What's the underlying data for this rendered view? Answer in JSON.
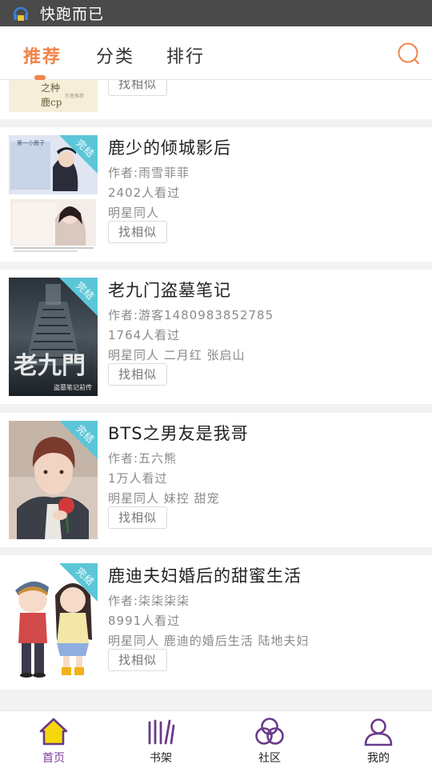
{
  "status_bar": {
    "app_name": "快跑而已"
  },
  "top_nav": {
    "tabs": [
      {
        "label": "推荐",
        "active": true
      },
      {
        "label": "分类",
        "active": false
      },
      {
        "label": "排行",
        "active": false
      }
    ],
    "accent_color": "#f0844a"
  },
  "partial_card": {
    "cover_text": "之种\n鹿cp",
    "similar_label": "找相似"
  },
  "books": [
    {
      "title": "鹿少的倾城影后",
      "author": "作者:雨雪菲菲",
      "views": "2402人看过",
      "tags": "明星同人",
      "similar_label": "找相似",
      "badge": "完结",
      "cover_icon": "cover-collage-portraits"
    },
    {
      "title": "老九门盗墓笔记",
      "author": "作者:游客1480983852785",
      "views": "1764人看过",
      "tags": "明星同人 二月红 张启山",
      "similar_label": "找相似",
      "badge": "完结",
      "cover_icon": "cover-dark-stairway",
      "cover_text": "老九門",
      "cover_subtext": "盗墓笔记前传"
    },
    {
      "title": "BTS之男友是我哥",
      "author": "作者:五六熊",
      "views": "1万人看过",
      "tags": "明星同人 妹控 甜宠",
      "similar_label": "找相似",
      "badge": "完结",
      "cover_icon": "cover-boy-with-rose"
    },
    {
      "title": "鹿迪夫妇婚后的甜蜜生活",
      "author": "作者:柒柒柒柒",
      "views": "8991人看过",
      "tags": "明星同人 鹿迪的婚后生活 陆地夫妇",
      "similar_label": "找相似",
      "badge": "完结",
      "cover_icon": "cover-cartoon-couple"
    }
  ],
  "bottom_nav": {
    "items": [
      {
        "label": "首页",
        "icon": "home-icon",
        "active": true
      },
      {
        "label": "书架",
        "icon": "bookshelf-icon",
        "active": false
      },
      {
        "label": "社区",
        "icon": "community-icon",
        "active": false
      },
      {
        "label": "我的",
        "icon": "profile-icon",
        "active": false
      }
    ],
    "active_color": "#7c3a9a",
    "icon_color": "#6a3a8a"
  }
}
